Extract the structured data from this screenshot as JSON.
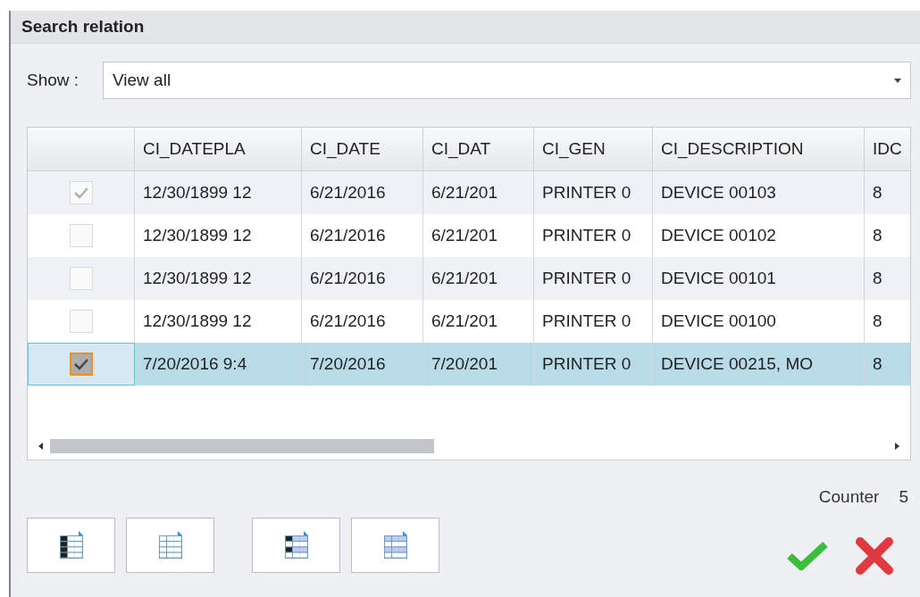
{
  "window": {
    "title": "Search relation"
  },
  "filter": {
    "label": "Show :",
    "value": "View all"
  },
  "table": {
    "columns": [
      "CI_DATEPLA",
      "CI_DATE",
      "CI_DAT",
      "CI_GEN",
      "CI_DESCRIPTION",
      "IDC"
    ],
    "rows": [
      {
        "checked": true,
        "selected": false,
        "cells": [
          "12/30/1899 12",
          "6/21/2016",
          "6/21/201",
          "PRINTER 0",
          "DEVICE 00103",
          "8"
        ]
      },
      {
        "checked": false,
        "selected": false,
        "cells": [
          "12/30/1899 12",
          "6/21/2016",
          "6/21/201",
          "PRINTER 0",
          "DEVICE 00102",
          "8"
        ]
      },
      {
        "checked": false,
        "selected": false,
        "cells": [
          "12/30/1899 12",
          "6/21/2016",
          "6/21/201",
          "PRINTER 0",
          "DEVICE 00101",
          "8"
        ]
      },
      {
        "checked": false,
        "selected": false,
        "cells": [
          "12/30/1899 12",
          "6/21/2016",
          "6/21/201",
          "PRINTER 0",
          "DEVICE 00100",
          "8"
        ]
      },
      {
        "checked": true,
        "selected": true,
        "cells": [
          "7/20/2016 9:4",
          "7/20/2016",
          "7/20/201",
          "PRINTER 0",
          "DEVICE 00215, MO",
          "8"
        ]
      }
    ]
  },
  "counter": {
    "label": "Counter",
    "value": "5"
  }
}
